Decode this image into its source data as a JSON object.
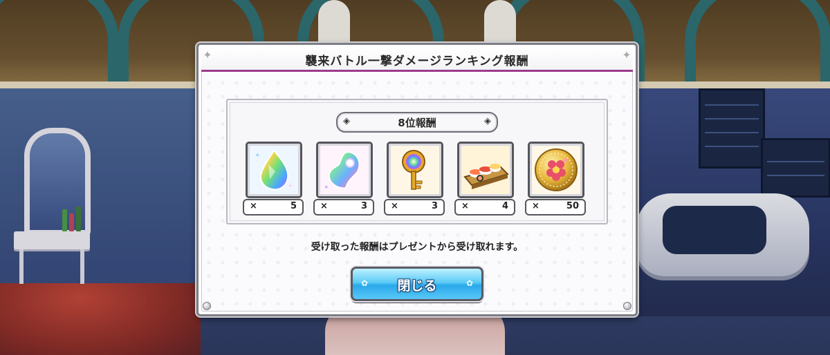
{
  "dialog": {
    "title": "襲来バトル一撃ダメージランキング報酬",
    "rank_label": "8位報酬",
    "note": "受け取った報酬はプレゼントから受け取れます。",
    "close_label": "閉じる"
  },
  "rewards": [
    {
      "icon": "rainbow-crystal-drop-icon",
      "x": "×",
      "count": "5"
    },
    {
      "icon": "rainbow-magatama-icon",
      "x": "×",
      "count": "3"
    },
    {
      "icon": "rainbow-key-icon",
      "x": "×",
      "count": "3"
    },
    {
      "icon": "sushi-platter-icon",
      "x": "×",
      "count": "4"
    },
    {
      "icon": "gold-flower-medal-icon",
      "x": "×",
      "count": "50"
    }
  ],
  "colors": {
    "header_accent": "#9c3a8a",
    "button_blue": "#2aa8ea"
  }
}
